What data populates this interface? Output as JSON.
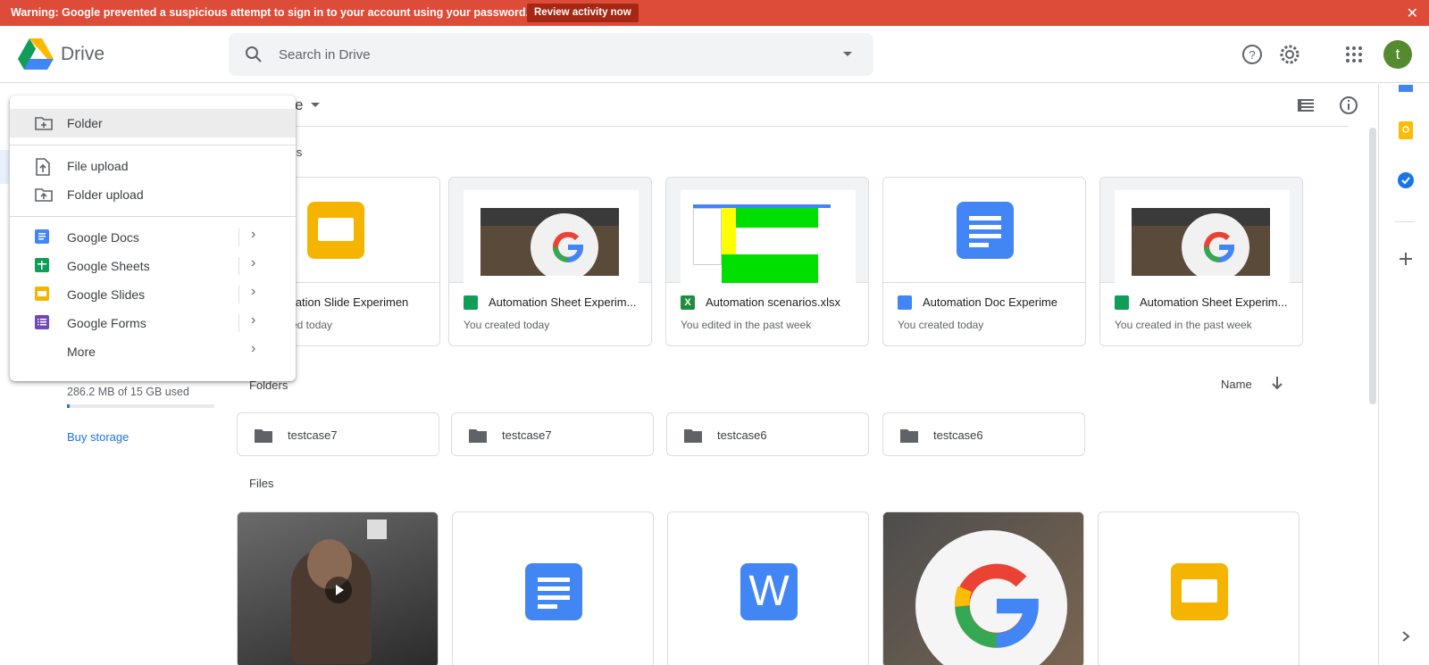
{
  "banner": {
    "text": "Warning: Google prevented a suspicious attempt to sign in to your account using your password.",
    "action_label": "Review activity now",
    "close_label": "✕"
  },
  "header": {
    "brand": "Drive",
    "search_placeholder": "Search in Drive",
    "avatar_letter": "t"
  },
  "toolbar": {
    "location_label": "e"
  },
  "menu": {
    "items": [
      {
        "label": "Folder"
      },
      {
        "label": "File upload"
      },
      {
        "label": "Folder upload"
      },
      {
        "label": "Google Docs"
      },
      {
        "label": "Google Sheets"
      },
      {
        "label": "Google Slides"
      },
      {
        "label": "Google Forms"
      },
      {
        "label": "More"
      }
    ]
  },
  "sidebar": {
    "storage_text": "286.2 MB of 15 GB used",
    "storage_fraction": 0.02,
    "buy_storage": "Buy storage"
  },
  "quick_access": {
    "label": "ess",
    "cards": [
      {
        "name": "mation Slide Experimen",
        "sub": "ed today",
        "type": "slides"
      },
      {
        "name": "Automation Sheet Experim...",
        "sub": "You created today",
        "type": "sheets"
      },
      {
        "name": "Automation scenarios.xlsx",
        "sub": "You edited in the past week",
        "type": "excel"
      },
      {
        "name": "Automation Doc Experime",
        "sub": "You created today",
        "type": "docs"
      },
      {
        "name": "Automation Sheet Experim...",
        "sub": "You created in the past week",
        "type": "sheets"
      }
    ]
  },
  "folders": {
    "label": "Folders",
    "sort_label": "Name",
    "items": [
      "testcase7",
      "testcase7",
      "testcase6",
      "testcase6"
    ]
  },
  "files": {
    "label": "Files",
    "word_letter": "W"
  },
  "colors": {
    "banner": "#dd4b39",
    "docs": "#4285f4",
    "sheets": "#0f9d58",
    "slides": "#f4b400",
    "forms": "#7248b9",
    "link": "#1a73e8"
  }
}
